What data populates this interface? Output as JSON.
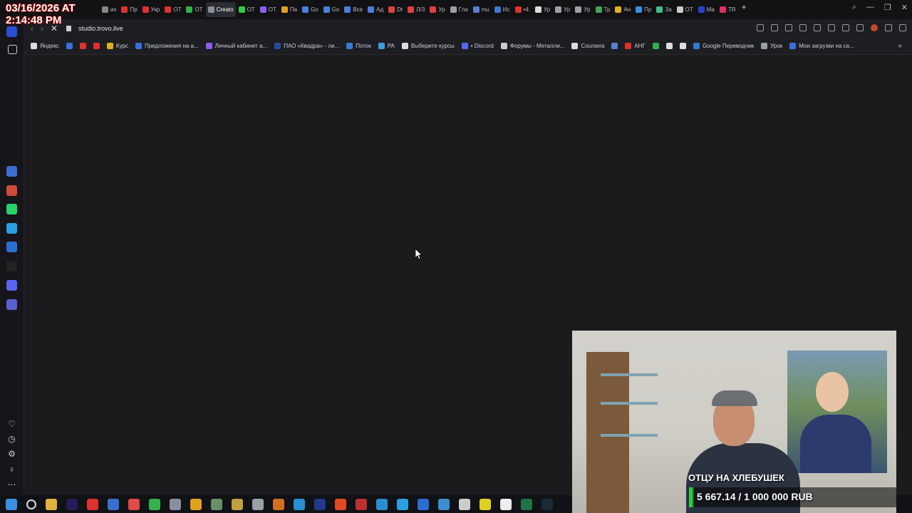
{
  "overlay": {
    "timestamp_line1": "03/16/2026 AT",
    "timestamp_line2": "2:14:48 PM"
  },
  "tabs": [
    {
      "label": "иx",
      "color": "#888888"
    },
    {
      "label": "Пр",
      "color": "#e03030"
    },
    {
      "label": "Укр",
      "color": "#e03030"
    },
    {
      "label": "ОТ",
      "color": "#e03030"
    },
    {
      "label": "ОТ",
      "color": "#35b04a"
    },
    {
      "label": "Creato",
      "color": "#8a8f99",
      "active": true
    },
    {
      "label": "ОТ",
      "color": "#2ecc40"
    },
    {
      "label": "ОТ",
      "color": "#8a5cf0"
    },
    {
      "label": "Па",
      "color": "#e0a020"
    },
    {
      "label": "Go",
      "color": "#4a7fe0"
    },
    {
      "label": "Go",
      "color": "#4a7fe0"
    },
    {
      "label": "Все",
      "color": "#4a7fe0"
    },
    {
      "label": "Ад",
      "color": "#4a7fe0"
    },
    {
      "label": "Dt",
      "color": "#e04040"
    },
    {
      "label": "Л/З",
      "color": "#e04040"
    },
    {
      "label": "Ур",
      "color": "#e04040"
    },
    {
      "label": "Гла",
      "color": "#9aa0a6"
    },
    {
      "label": "mu",
      "color": "#5a7fd0"
    },
    {
      "label": "Ис",
      "color": "#3a78d0"
    },
    {
      "label": "•4:",
      "color": "#e03030"
    },
    {
      "label": "Ур",
      "color": "#dddddd"
    },
    {
      "label": "Ур",
      "color": "#9aa0a6"
    },
    {
      "label": "Ур",
      "color": "#9aa0a6"
    },
    {
      "label": "Тр",
      "color": "#4a9f5a"
    },
    {
      "label": "Ан",
      "color": "#e0b020"
    },
    {
      "label": "Пр",
      "color": "#3a8fe0"
    },
    {
      "label": "За",
      "color": "#3abf8a"
    },
    {
      "label": "ОТ",
      "color": "#cccccc"
    },
    {
      "label": "Ма",
      "color": "#2a3fd0"
    },
    {
      "label": "TR",
      "color": "#e03060"
    }
  ],
  "address": {
    "url": "studio.trovo.live"
  },
  "bookmarks": [
    {
      "label": "Яндекс",
      "color": "#dddddd"
    },
    {
      "label": "",
      "color": "#3a6fe0"
    },
    {
      "label": "",
      "color": "#e03030"
    },
    {
      "label": "",
      "color": "#e03030"
    },
    {
      "label": "Курс",
      "color": "#e0b020"
    },
    {
      "label": "Предложения на а...",
      "color": "#3a6fe0"
    },
    {
      "label": "Личный кабинет а...",
      "color": "#8a5cf0"
    },
    {
      "label": "ПАО «Квадра» - ли...",
      "color": "#2a4a9a"
    },
    {
      "label": "Поток",
      "color": "#3a78d0"
    },
    {
      "label": "PA",
      "color": "#3a9fe0"
    },
    {
      "label": "Выберите курсы",
      "color": "#dddddd"
    },
    {
      "label": "• Discord",
      "color": "#5865f2"
    },
    {
      "label": "Форумы - Металли...",
      "color": "#cccccc"
    },
    {
      "label": "Coursera",
      "color": "#dddddd"
    },
    {
      "label": "",
      "color": "#5a7fd0"
    },
    {
      "label": "АНГ",
      "color": "#e03030"
    },
    {
      "label": "",
      "color": "#35b04a"
    },
    {
      "label": "",
      "color": "#dddddd"
    },
    {
      "label": "",
      "color": "#dddddd"
    },
    {
      "label": "Google Переводчик",
      "color": "#3a78d0"
    },
    {
      "label": "Урок",
      "color": "#9aa0a6"
    },
    {
      "label": "Мои загрузки на са...",
      "color": "#3a6fe0"
    }
  ],
  "sidebar_icons": [
    {
      "name": "home-icon",
      "color": "#2a4fd0"
    },
    {
      "name": "star-icon",
      "color": ""
    },
    {
      "name": "aria-icon",
      "color": "#3a6fd0"
    },
    {
      "name": "gmail-icon",
      "color": "#d04a3a"
    },
    {
      "name": "whatsapp-icon",
      "color": "#25d366"
    },
    {
      "name": "telegram-icon",
      "color": "#2aa0e0"
    },
    {
      "name": "vk-icon",
      "color": "#2a6fd0"
    },
    {
      "name": "x-icon",
      "color": "#222222"
    },
    {
      "name": "discord-icon",
      "color": "#5865f2"
    },
    {
      "name": "app-icon",
      "color": "#5a5fd0"
    }
  ],
  "taskbar_icons": [
    {
      "name": "start-icon",
      "color": "#3a8fe0"
    },
    {
      "name": "search-icon",
      "color": ""
    },
    {
      "name": "explorer-icon",
      "color": "#e0b040"
    },
    {
      "name": "premiere-icon",
      "color": "#2a1a5a"
    },
    {
      "name": "yandex-icon",
      "color": "#e03030"
    },
    {
      "name": "app-icon",
      "color": "#3a6fd0"
    },
    {
      "name": "yandex-browser-icon",
      "color": "#e04a4a"
    },
    {
      "name": "app-icon",
      "color": "#35b04a"
    },
    {
      "name": "calculator-icon",
      "color": "#8a8fa0"
    },
    {
      "name": "chrome-icon",
      "color": "#e0a020"
    },
    {
      "name": "app-icon",
      "color": "#6a8f6a"
    },
    {
      "name": "app-icon",
      "color": "#c0a040"
    },
    {
      "name": "settings-icon",
      "color": "#9aa0a6"
    },
    {
      "name": "app-icon",
      "color": "#d07020"
    },
    {
      "name": "app-icon",
      "color": "#2a8fd0"
    },
    {
      "name": "photoshop-icon",
      "color": "#1f3a8a"
    },
    {
      "name": "brave-icon",
      "color": "#e04a20"
    },
    {
      "name": "app-icon",
      "color": "#c03030"
    },
    {
      "name": "app-icon",
      "color": "#2a8fd0"
    },
    {
      "name": "telegram-icon",
      "color": "#2aa0e0"
    },
    {
      "name": "edge-icon",
      "color": "#2a6fd0"
    },
    {
      "name": "edge-icon",
      "color": "#3a8fd0"
    },
    {
      "name": "app-icon",
      "color": "#cccccc"
    },
    {
      "name": "app-icon",
      "color": "#e0d020"
    },
    {
      "name": "notepad-icon",
      "color": "#eeeeee"
    },
    {
      "name": "excel-icon",
      "color": "#217346"
    },
    {
      "name": "steam-icon",
      "color": "#1b2838"
    }
  ],
  "webcam": {
    "caption": "ОТЦУ НА ХЛЕБУШЕК",
    "goal_text": "5 667.14 / 1 000 000 RUB",
    "goal_progress": 0.0057
  }
}
